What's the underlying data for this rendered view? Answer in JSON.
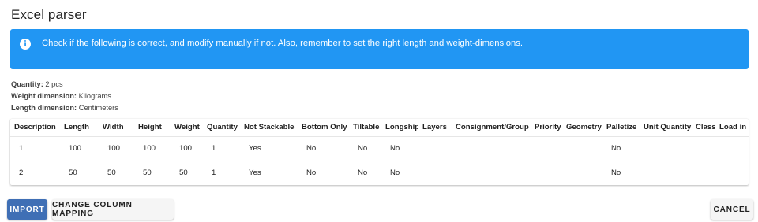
{
  "dialog": {
    "title": "Excel parser"
  },
  "banner": {
    "icon": "info-icon",
    "message": "Check if the following is correct, and modify manually if not. Also, remember to set the right length and weight-dimensions.",
    "color": "#2196f3"
  },
  "meta": {
    "quantity_label": "Quantity:",
    "quantity_value": "2 pcs",
    "weight_label": "Weight dimension:",
    "weight_value": "Kilograms",
    "length_label": "Length dimension:",
    "length_value": "Centimeters"
  },
  "table": {
    "columns": [
      "Description",
      "Length",
      "Width",
      "Height",
      "Weight",
      "Quantity",
      "Not Stackable",
      "Bottom Only",
      "Tiltable",
      "Longship",
      "Layers",
      "Consignment/Group",
      "Priority",
      "Geometry",
      "Palletize",
      "Unit Quantity",
      "Class",
      "Load in"
    ],
    "rows": [
      [
        "1",
        "100",
        "100",
        "100",
        "100",
        "1",
        "Yes",
        "No",
        "No",
        "No",
        "",
        "",
        "",
        "",
        "No",
        "",
        "",
        ""
      ],
      [
        "2",
        "50",
        "50",
        "50",
        "50",
        "1",
        "Yes",
        "No",
        "No",
        "No",
        "",
        "",
        "",
        "",
        "No",
        "",
        "",
        ""
      ]
    ]
  },
  "buttons": {
    "import": "IMPORT",
    "change_mapping": "CHANGE COLUMN MAPPING",
    "cancel": "CANCEL"
  },
  "colors": {
    "primary_button": "#3f6fb5",
    "banner": "#2196f3"
  }
}
